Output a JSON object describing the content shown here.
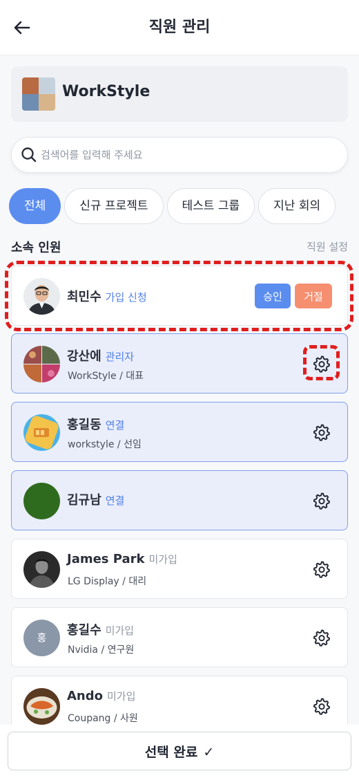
{
  "header": {
    "title": "직원 관리",
    "back_icon": "arrow-left-icon"
  },
  "workspace": {
    "name": "WorkStyle"
  },
  "search": {
    "placeholder": "검색어를 입력해 주세요",
    "value": ""
  },
  "filters": [
    {
      "label": "전체",
      "active": true
    },
    {
      "label": "신규 프로젝트",
      "active": false
    },
    {
      "label": "테스트 그룹",
      "active": false
    },
    {
      "label": "지난 회의",
      "active": false
    }
  ],
  "section": {
    "title": "소속 인원",
    "link": "직원 설정"
  },
  "request": {
    "name": "최민수",
    "status": "가입 신청",
    "approve_label": "승인",
    "reject_label": "거절"
  },
  "members": [
    {
      "name": "강산에",
      "tag": "관리자",
      "sub": "WorkStyle / 대표",
      "selected": true
    },
    {
      "name": "홍길동",
      "tag": "연결",
      "sub": "workstyle / 선임",
      "selected": true
    },
    {
      "name": "김규남",
      "tag": "연결",
      "sub": "",
      "selected": true
    },
    {
      "name": "James Park",
      "tag": "미가입",
      "sub": "LG Display / 대리",
      "selected": false
    },
    {
      "name": "홍길수",
      "tag": "미가입",
      "sub": "Nvidia / 연구원",
      "selected": false,
      "initial": "홍"
    },
    {
      "name": "Ando",
      "tag": "미가입",
      "sub": "Coupang / 사원",
      "selected": false
    }
  ],
  "footer": {
    "complete_label": "선택 완료",
    "check": "✓"
  },
  "colors": {
    "accent": "#5b8def",
    "reject": "#f58f70",
    "selected_bg": "#eaeefb",
    "highlight": "#e01e1e"
  }
}
